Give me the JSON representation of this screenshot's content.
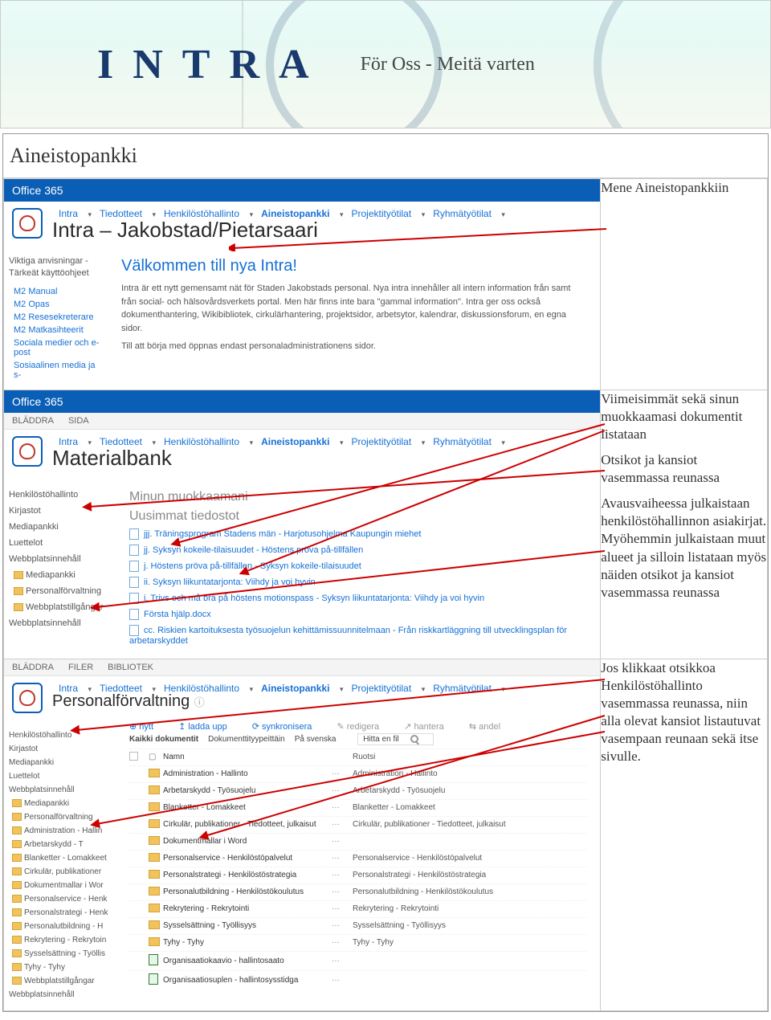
{
  "banner": {
    "wordmark": "INTRA",
    "tagline": "För Oss - Meitä varten"
  },
  "section_title": "Aineistopankki",
  "office365_label": "Office 365",
  "row1": {
    "nav": [
      "Intra",
      "Tiedotteet",
      "Henkilöstöhallinto",
      "Aineistopankki",
      "Projektityötilat",
      "Ryhmätyötilat"
    ],
    "site_title": "Intra – Jakobstad/Pietarsaari",
    "sidebar_group": "Viktiga anvisningar - Tärkeät käyttöohjeet",
    "sidebar": [
      "M2 Manual",
      "M2 Opas",
      "M2 Resesekreterare",
      "M2 Matkasihteerit",
      "Sociala medier och e-post",
      "Sosiaalinen media ja s-"
    ],
    "welcome": "Välkommen till nya Intra!",
    "para1": "Intra är ett nytt gemensamt nät för Staden Jakobstads personal. Nya intra innehåller all intern information från samt från social- och hälsovårdsverkets portal. Men här finns inte bara \"gammal information\". Intra ger oss också dokumenthantering, Wikibibliotek, cirkulärhantering, projektsidor, arbetsytor, kalendrar, diskussionsforum, en egna sidor.",
    "para2": "Till att börja med öppnas endast personaladministrationens sidor.",
    "annotation": "Mene Aineistopankkiin"
  },
  "row2": {
    "sp_tabs": [
      "BLÄDDRA",
      "SIDA"
    ],
    "nav": [
      "Intra",
      "Tiedotteet",
      "Henkilöstöhallinto",
      "Aineistopankki",
      "Projektityötilat",
      "Ryhmätyötilat"
    ],
    "site_title": "Materialbank",
    "sidebar": [
      "Henkilöstöhallinto",
      "Kirjastot",
      "Mediapankki",
      "Luettelot",
      "Webbplatsinnehåll"
    ],
    "sidebar_sub": [
      "Mediapankki",
      "Personalförvaltning",
      "Webbplatstillgångar"
    ],
    "sidebar_tail": "Webbplatsinnehåll",
    "h1": "Minun muokkaamani",
    "h2": "Uusimmat tiedostot",
    "files": [
      "jjj. Träningsprogram Stadens män - Harjotusohjelma Kaupungin miehet",
      "jj. Syksyn kokeile-tilaisuudet - Höstens pröva på-tillfällen",
      "j. Höstens pröva på-tillfällen - Syksyn kokeile-tilaisuudet",
      "ii. Syksyn liikuntatarjonta: Viihdy ja voi hyvin",
      "i. Trivs och må bra på höstens motionspass - Syksyn liikuntatarjonta: Viihdy ja voi hyvin",
      "Första hjälp.docx",
      "cc. Riskien kartoituksesta työsuojelun kehittämissuunnitelmaan - Från riskkartläggning till utvecklingsplan för arbetarskyddet"
    ],
    "annotation_p1": "Viimeisimmät sekä sinun muokkaamasi dokumentit listataan",
    "annotation_p2": "Otsikot ja kansiot vasemmassa reunassa",
    "annotation_p3": "Avausvaiheessa julkaistaan henkilöstöhallinnon asiakirjat. Myöhemmin julkaistaan muut alueet ja silloin listataan myös näiden otsikot ja kansiot vasemmassa reunassa"
  },
  "row3": {
    "sp_tabs": [
      "BLÄDDRA",
      "FILER",
      "BIBLIOTEK"
    ],
    "nav": [
      "Intra",
      "Tiedotteet",
      "Henkilöstöhallinto",
      "Aineistopankki",
      "Projektityötilat",
      "Ryhmätyötilat"
    ],
    "site_title": "Personalförvaltning",
    "site_title_sym": "ⓘ",
    "sidebar": [
      "Henkilöstöhallinto",
      "Kirjastot",
      "Mediapankki",
      "Luettelot",
      "Webbplatsinnehåll"
    ],
    "sidebar_sub": [
      "Mediapankki",
      "Personalförvaltning",
      "Administration - Hallin",
      "Arbetarskydd - T",
      "Blanketter - Lomakkeet",
      "Cirkulär, publikationer",
      "Dokumentmallar i Wor",
      "Personalservice - Henk",
      "Personalstrategi - Henk",
      "Personalutbildning - H",
      "Rekrytering - Rekrytoin",
      "Sysselsättning - Työllis",
      "Tyhy - Tyhy",
      "Webbplatstillgångar"
    ],
    "sidebar_tail": "Webbplatsinnehåll",
    "toolbar": {
      "new": "nytt",
      "upload": "ladda upp",
      "sync": "synkronisera",
      "edit": "redigera",
      "manage": "hantera",
      "share": "andel"
    },
    "tabs": [
      "Kaikki dokumentit",
      "Dokumenttityypeittäin",
      "På svenska"
    ],
    "search_placeholder": "Hitta en fil",
    "cols": {
      "name": "Namn",
      "name2": "Ruotsi"
    },
    "rows": [
      {
        "t": "f",
        "n": "Administration - Hallinto",
        "n2": "Administration - Hallinto"
      },
      {
        "t": "f",
        "n": "Arbetarskydd - Työsuojelu",
        "n2": "Arbetarskydd - Työsuojelu"
      },
      {
        "t": "f",
        "n": "Blanketter - Lomakkeet",
        "n2": "Blanketter - Lomakkeet"
      },
      {
        "t": "f",
        "n": "Cirkulär, publikationer - Tiedotteet, julkaisut",
        "n2": "Cirkulär, publikationer - Tiedotteet, julkaisut"
      },
      {
        "t": "f",
        "n": "Dokumentmallar i Word",
        "n2": ""
      },
      {
        "t": "f",
        "n": "Personalservice - Henkilöstöpalvelut",
        "n2": "Personalservice - Henkilöstöpalvelut"
      },
      {
        "t": "f",
        "n": "Personalstrategi - Henkilöstöstrategia",
        "n2": "Personalstrategi - Henkilöstöstrategia"
      },
      {
        "t": "f",
        "n": "Personalutbildning - Henkilöstökoulutus",
        "n2": "Personalutbildning - Henkilöstökoulutus"
      },
      {
        "t": "f",
        "n": "Rekrytering - Rekrytointi",
        "n2": "Rekrytering - Rekrytointi"
      },
      {
        "t": "f",
        "n": "Sysselsättning - Työllisyys",
        "n2": "Sysselsättning - Työllisyys"
      },
      {
        "t": "f",
        "n": "Tyhy - Tyhy",
        "n2": "Tyhy - Tyhy"
      },
      {
        "t": "x",
        "n": "Organisaatiokaavio - hallintosaato",
        "n2": ""
      },
      {
        "t": "x",
        "n": "Organisaatiosuplen - hallintosysstidga",
        "n2": ""
      }
    ],
    "annotation": "Jos klikkaat otsikkoa Henkilöstöhallinto vasemmassa reunassa, niin alla olevat kansiot listautuvat vasempaan reunaan sekä itse sivulle."
  }
}
